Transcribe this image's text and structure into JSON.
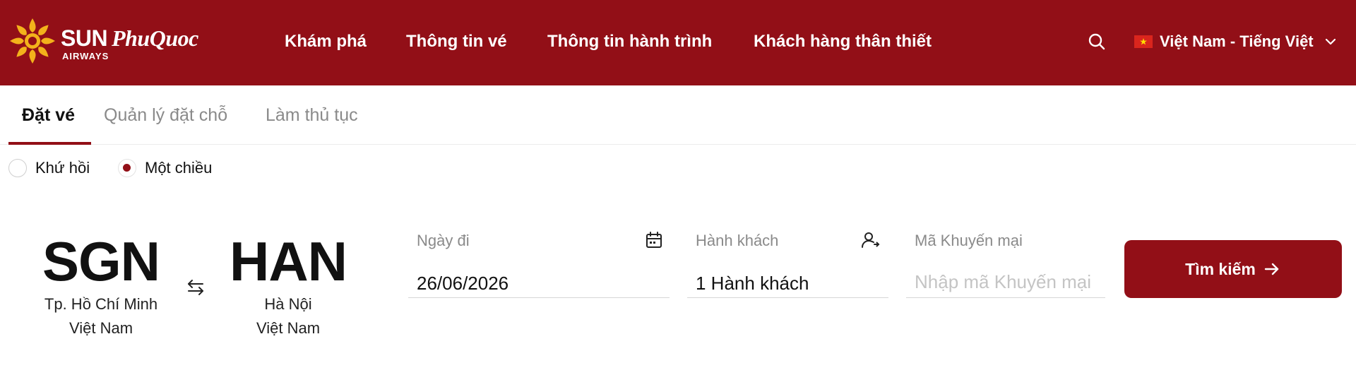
{
  "colors": {
    "brand": "#920f17",
    "header_text": "#ffffff",
    "muted": "#8a8a8a",
    "placeholder": "#c4c4c4"
  },
  "header": {
    "logo": {
      "brand_sun": "SUN",
      "brand_pq": "PhuQuoc",
      "sub": "AIRWAYS"
    },
    "nav": [
      {
        "label": "Khám phá"
      },
      {
        "label": "Thông tin vé"
      },
      {
        "label": "Thông tin hành trình"
      },
      {
        "label": "Khách hàng thân thiết"
      }
    ],
    "search_icon": "search-icon",
    "language": {
      "flag": "vietnam-flag-icon",
      "label": "Việt Nam - Tiếng Việt",
      "chevron": "chevron-down-icon"
    }
  },
  "tabs": [
    {
      "label": "Đặt vé",
      "active": true
    },
    {
      "label": "Quản lý đặt chỗ",
      "active": false
    },
    {
      "label": "Làm thủ tục",
      "active": false
    }
  ],
  "trip_type": {
    "options": [
      {
        "label": "Khứ hồi",
        "checked": false
      },
      {
        "label": "Một chiều",
        "checked": true
      }
    ]
  },
  "route": {
    "from": {
      "code": "SGN",
      "city": "Tp. Hồ Chí Minh",
      "country": "Việt Nam"
    },
    "to": {
      "code": "HAN",
      "city": "Hà Nội",
      "country": "Việt Nam"
    },
    "swap_icon": "swap-arrows-icon"
  },
  "form": {
    "depart": {
      "label": "Ngày đi",
      "value": "26/06/2026",
      "icon": "calendar-icon"
    },
    "passengers": {
      "label": "Hành khách",
      "value": "1 Hành khách",
      "icon": "user-icon"
    },
    "promo": {
      "label": "Mã Khuyến mại",
      "placeholder": "Nhập mã Khuyến mại",
      "value": ""
    },
    "submit": {
      "label": "Tìm kiếm",
      "icon": "arrow-right-icon"
    }
  }
}
